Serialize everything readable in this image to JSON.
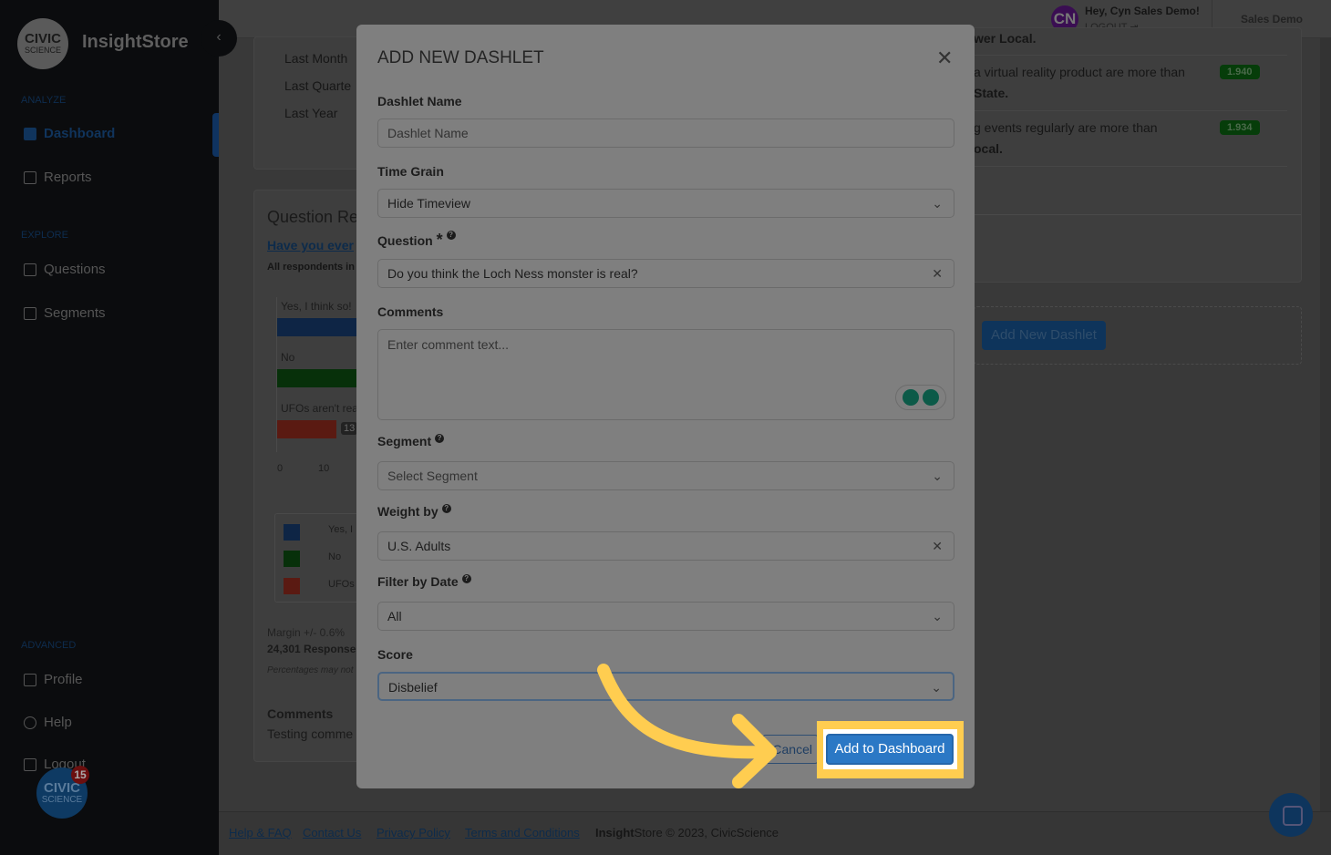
{
  "sidebar": {
    "logo": "CIVIC SCIENCE",
    "brand": "InsightStore",
    "sections": {
      "analyze": "ANALYZE",
      "explore": "EXPLORE",
      "advanced": "ADVANCED"
    },
    "items": [
      {
        "label": "Dashboard",
        "icon": "dashboard-icon"
      },
      {
        "label": "Reports",
        "icon": "report-icon"
      },
      {
        "label": "Questions",
        "icon": "question-icon"
      },
      {
        "label": "Segments",
        "icon": "segments-icon"
      },
      {
        "label": "Profile",
        "icon": "profile-icon"
      },
      {
        "label": "Help",
        "icon": "lifebuoy-icon"
      },
      {
        "label": "Logout",
        "icon": "logout-icon"
      }
    ],
    "chat_badge": "15"
  },
  "header": {
    "avatar": "CN",
    "greeting": "Hey, Cyn Sales Demo!",
    "logout": "LOGOUT",
    "account": "Sales Demo"
  },
  "background": {
    "time_options": [
      "Last Month",
      "Last Quarte",
      "Last Year"
    ],
    "card_title": "Question Re",
    "question_link": "Have you ever",
    "respondents": "All respondents in",
    "chart": {
      "bars": [
        {
          "label": "Yes, I think so!",
          "color": "#0e2545"
        },
        {
          "label": "No",
          "color": "#07300a"
        },
        {
          "label": "UFOs aren't rea",
          "color": "#5a1a12",
          "value_label": "13"
        }
      ],
      "ticks": [
        "0",
        "10"
      ],
      "legend": [
        "Yes, I",
        "No",
        "UFOs"
      ]
    },
    "margin": "Margin +/- 0.6%",
    "responses": "24,301 Responses",
    "note": "Percentages may not",
    "comments_title": "Comments",
    "comments_text": "Testing comme",
    "insights": [
      {
        "line1": "wer Local."
      },
      {
        "line1": "a virtual reality product are more than",
        "line2": "State.",
        "score": "1.940"
      },
      {
        "line1": "g events regularly are more than",
        "line2": "ocal.",
        "score": "1.934"
      }
    ],
    "add_new_dashlet": "Add New Dashlet"
  },
  "modal": {
    "title": "ADD NEW DASHLET",
    "fields": {
      "name_label": "Dashlet Name",
      "name_placeholder": "Dashlet Name",
      "grain_label": "Time Grain",
      "grain_value": "Hide Timeview",
      "question_label": "Question",
      "required": "*",
      "question_value": "Do you think the Loch Ness monster is real?",
      "comments_label": "Comments",
      "comments_placeholder": "Enter comment text...",
      "segment_label": "Segment",
      "segment_value": "Select Segment",
      "weight_label": "Weight by",
      "weight_value": "U.S. Adults",
      "date_label": "Filter by Date",
      "date_value": "All",
      "score_label": "Score",
      "score_value": "Disbelief"
    },
    "cancel": "Cancel",
    "submit": "Add to Dashboard"
  },
  "footer": {
    "links": [
      "Help & FAQ",
      "Contact Us",
      "Privacy Policy",
      "Terms and Conditions"
    ],
    "brand_bold": "Insight",
    "copyright": "Store © 2023, CivicScience"
  },
  "colors": {
    "highlight": "#ffcd50",
    "primary": "#2b78c5"
  }
}
